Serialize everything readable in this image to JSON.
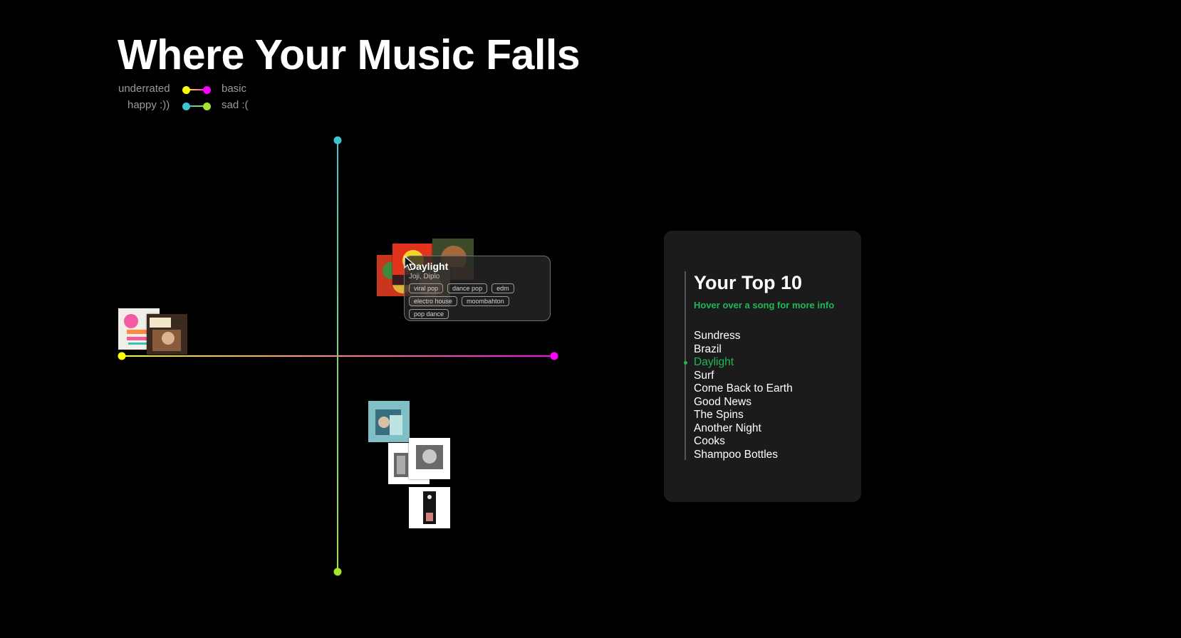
{
  "title": "Where Your Music Falls",
  "legend": {
    "row1": {
      "left": "underrated",
      "right": "basic",
      "left_color": "#ffff00",
      "right_color": "#ff00ff"
    },
    "row2": {
      "left": "happy :))",
      "right": "sad :(",
      "left_color": "#3ec5d0",
      "right_color": "#a6e22e"
    }
  },
  "axes": {
    "x_start_color": "#ffff00",
    "x_end_color": "#ff00ff",
    "y_start_color": "#3ec5d0",
    "y_end_color": "#a6e22e"
  },
  "tooltip": {
    "title": "Daylight",
    "artist": "Joji, Diplo",
    "tags": [
      "viral pop",
      "dance pop",
      "edm",
      "electro house",
      "moombahton",
      "pop dance"
    ]
  },
  "panel": {
    "heading": "Your Top 10",
    "hint": "Hover over a song for more info",
    "songs": [
      "Sundress",
      "Brazil",
      "Daylight",
      "Surf",
      "Come Back to Earth",
      "Good News",
      "The Spins",
      "Another Night",
      "Cooks",
      "Shampoo Bottles"
    ],
    "active_index": 2,
    "accent": "#1db954"
  }
}
